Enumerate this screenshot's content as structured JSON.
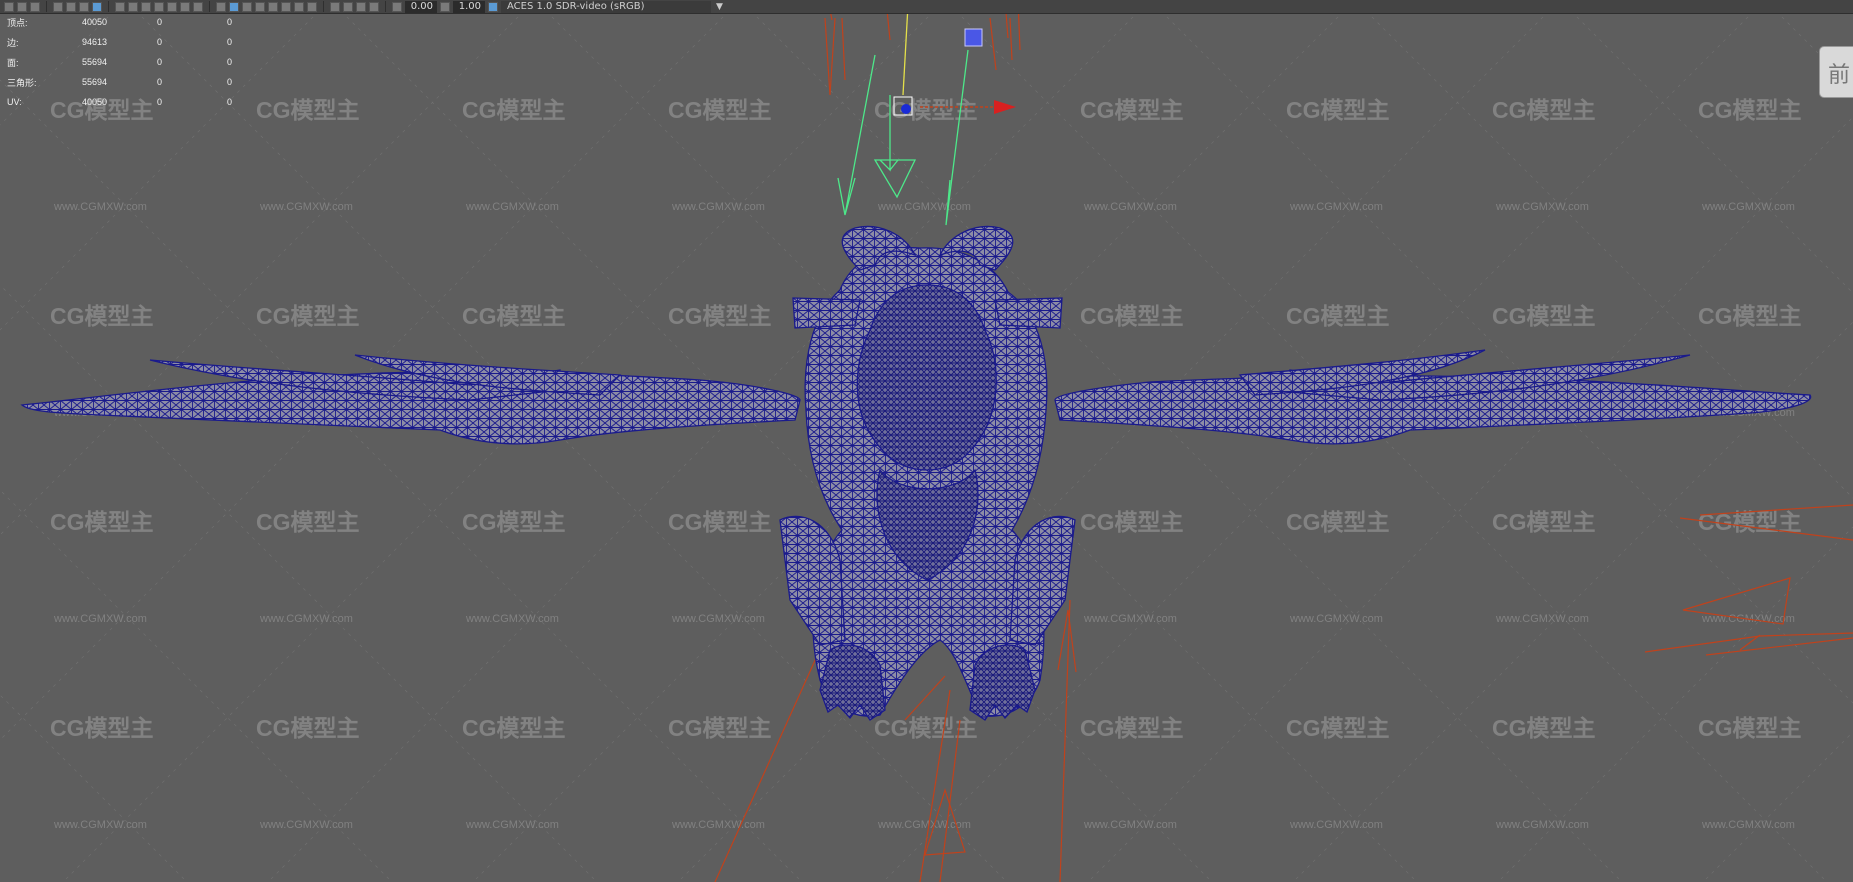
{
  "toolbar": {
    "exposure": "0.00",
    "gamma": "1.00",
    "colorspace": "ACES 1.0 SDR-video (sRGB)",
    "dropdown_icon": "chevron-down-icon"
  },
  "hud": {
    "rows": [
      {
        "label": "顶点:",
        "value": "40050",
        "z1": "0",
        "z2": "0"
      },
      {
        "label": "边:",
        "value": "94613",
        "z1": "0",
        "z2": "0"
      },
      {
        "label": "面:",
        "value": "55694",
        "z1": "0",
        "z2": "0"
      },
      {
        "label": "三角形:",
        "value": "55694",
        "z1": "0",
        "z2": "0"
      },
      {
        "label": "UV:",
        "value": "40050",
        "z1": "0",
        "z2": "0"
      }
    ]
  },
  "view_label": "前",
  "watermark": {
    "logo_text": "CG模型主",
    "url_text": "www.CGMXW.com"
  },
  "colors": {
    "viewport_bg": "#5e5e5e",
    "wireframe": "#1a1a8c",
    "mesh_fill": "#8d8da6",
    "light_lines": "#c0421c",
    "camera_lines": "#4de88a"
  }
}
